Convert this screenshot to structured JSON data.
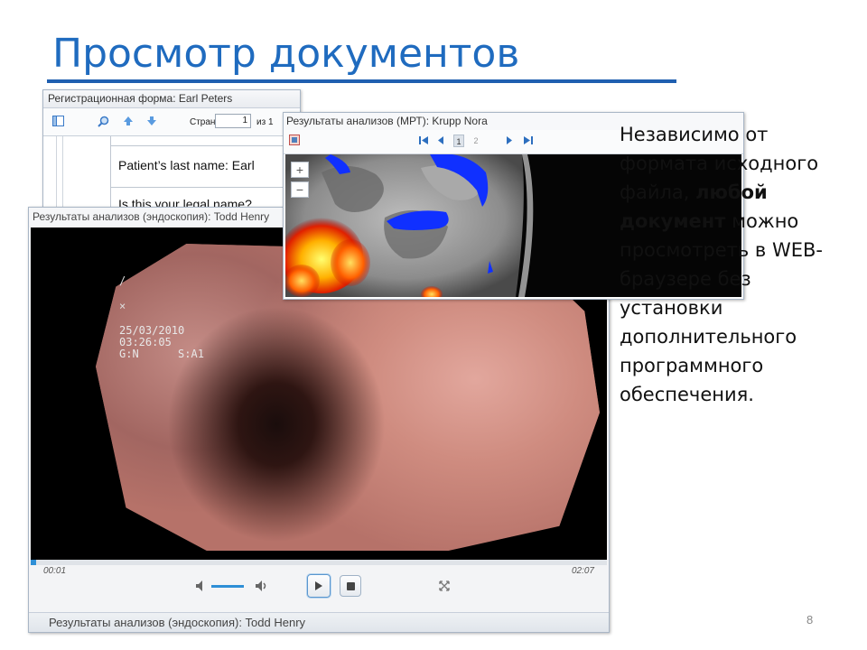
{
  "slide": {
    "title": "Просмотр документов",
    "page_number": "8"
  },
  "doc_viewer": {
    "title": "Регистрационная форма: Earl Peters",
    "page_label": "Страница:",
    "page_value": "1",
    "page_of": "из 1",
    "lines": [
      "Patient’s last name: Earl",
      "Is this your legal name?"
    ]
  },
  "endoscopy": {
    "title": "Результаты анализов (эндоскопия): Todd Henry",
    "osd_text": "25/03/2010\n03:26:05\nG:N      S:A1",
    "time_current": "00:01",
    "time_total": "02:07",
    "progress": 0.01,
    "volume": 0.7,
    "footer": "Результаты анализов (эндоскопия): Todd Henry"
  },
  "mri": {
    "title": "Результаты анализов (МРТ): Krupp Nora",
    "pages": [
      "1",
      "2"
    ],
    "current_page": "1",
    "zoom_in": "+",
    "zoom_out": "−"
  },
  "description": {
    "part1": "Независимо от формата исходного файла, ",
    "bold": "любой документ",
    "part2": " можно просмотреть в WEB-браузере без установки дополнительного программного обеспечения."
  },
  "colors": {
    "title_blue": "#1f6bbf",
    "accent": "#2e8fd6"
  },
  "icons": [
    "sidebar-toggle-icon",
    "search-icon",
    "arrow-up-icon",
    "arrow-down-icon",
    "first-page-icon",
    "prev-page-icon",
    "next-page-icon",
    "last-page-icon",
    "volume-icon",
    "play-icon",
    "stop-icon",
    "fullscreen-icon"
  ]
}
